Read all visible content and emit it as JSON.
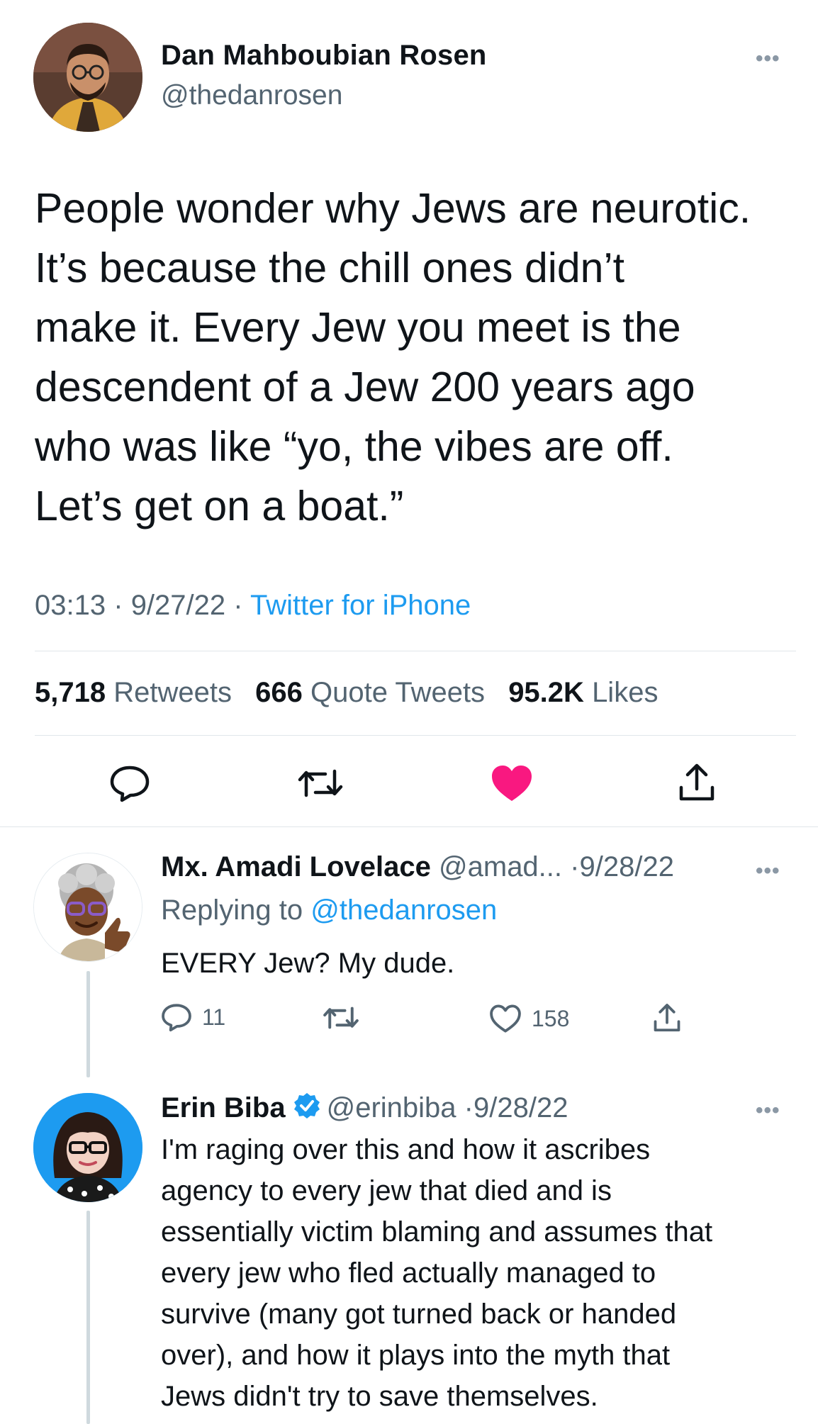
{
  "main_tweet": {
    "author_name": "Dan Mahboubian Rosen",
    "author_handle": "@thedanrosen",
    "text_lines": [
      "People wonder why Jews are neurotic.",
      "It’s because the chill ones didn’t",
      "make it. Every Jew you meet is the",
      "descendent of a Jew 200 years ago",
      "who was like “yo, the vibes are off.",
      "Let’s get on a boat.”"
    ],
    "time": "03:13",
    "date": "9/27/22",
    "separator": "·",
    "source": "Twitter for iPhone",
    "stats": {
      "retweets_count": "5,718",
      "retweets_label": "Retweets",
      "quotes_count": "666",
      "quotes_label": "Quote Tweets",
      "likes_count": "95.2K",
      "likes_label": "Likes"
    },
    "liked": true,
    "icons": [
      "reply-icon",
      "retweet-icon",
      "like-icon",
      "share-icon"
    ],
    "colors": {
      "like": "#f91880",
      "link": "#1d9bf0",
      "muted": "#536471"
    }
  },
  "replies": [
    {
      "author_name": "Mx. Amadi Lovelace",
      "author_handle": "@amad...",
      "separator": "·",
      "date": "9/28/22",
      "replying_prefix": "Replying to",
      "replying_to": "@thedanrosen",
      "text_lines": [
        "EVERY Jew? My dude."
      ],
      "reply_count": "11",
      "like_count": "158"
    },
    {
      "author_name": "Erin Biba",
      "verified": true,
      "author_handle": "@erinbiba",
      "separator": "·",
      "date": "9/28/22",
      "text_lines": [
        "I'm raging over this and how it ascribes",
        "agency to every jew that died and is",
        "essentially victim blaming and assumes that",
        "every jew who fled actually managed to",
        "survive (many got turned back or handed",
        "over), and how it plays into the myth that",
        "Jews didn't try to save themselves."
      ]
    }
  ]
}
